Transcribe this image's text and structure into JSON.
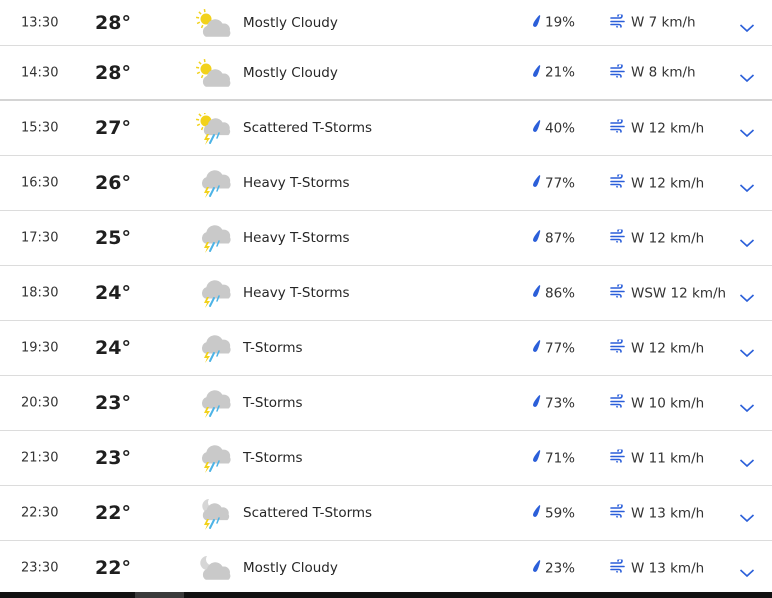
{
  "colors": {
    "accent": "#2b5fd9",
    "divider": "#dcdcdc",
    "cloud": "#c9c9c9",
    "sun": "#f2d21b",
    "bolt": "#f2d21b",
    "rain": "#4cb3e6"
  },
  "hourly": [
    {
      "time": "13:30",
      "temp": "28°",
      "icon": "partly-cloudy-day-icon",
      "condition": "Mostly Cloudy",
      "precip": "19%",
      "wind": "W 7 km/h"
    },
    {
      "time": "14:30",
      "temp": "28°",
      "icon": "partly-cloudy-day-icon",
      "condition": "Mostly Cloudy",
      "precip": "21%",
      "wind": "W 8 km/h"
    },
    {
      "time": "15:30",
      "temp": "27°",
      "icon": "scattered-tstorms-day-icon",
      "condition": "Scattered T-Storms",
      "precip": "40%",
      "wind": "W 12 km/h"
    },
    {
      "time": "16:30",
      "temp": "26°",
      "icon": "tstorms-icon",
      "condition": "Heavy T-Storms",
      "precip": "77%",
      "wind": "W 12 km/h"
    },
    {
      "time": "17:30",
      "temp": "25°",
      "icon": "tstorms-icon",
      "condition": "Heavy T-Storms",
      "precip": "87%",
      "wind": "W 12 km/h"
    },
    {
      "time": "18:30",
      "temp": "24°",
      "icon": "tstorms-icon",
      "condition": "Heavy T-Storms",
      "precip": "86%",
      "wind": "WSW 12 km/h"
    },
    {
      "time": "19:30",
      "temp": "24°",
      "icon": "tstorms-icon",
      "condition": "T-Storms",
      "precip": "77%",
      "wind": "W 12 km/h"
    },
    {
      "time": "20:30",
      "temp": "23°",
      "icon": "tstorms-icon",
      "condition": "T-Storms",
      "precip": "73%",
      "wind": "W 10 km/h"
    },
    {
      "time": "21:30",
      "temp": "23°",
      "icon": "tstorms-icon",
      "condition": "T-Storms",
      "precip": "71%",
      "wind": "W 11 km/h"
    },
    {
      "time": "22:30",
      "temp": "22°",
      "icon": "scattered-tstorms-night-icon",
      "condition": "Scattered T-Storms",
      "precip": "59%",
      "wind": "W 13 km/h"
    },
    {
      "time": "23:30",
      "temp": "22°",
      "icon": "mostly-cloudy-night-icon",
      "condition": "Mostly Cloudy",
      "precip": "23%",
      "wind": "W 13 km/h"
    }
  ]
}
